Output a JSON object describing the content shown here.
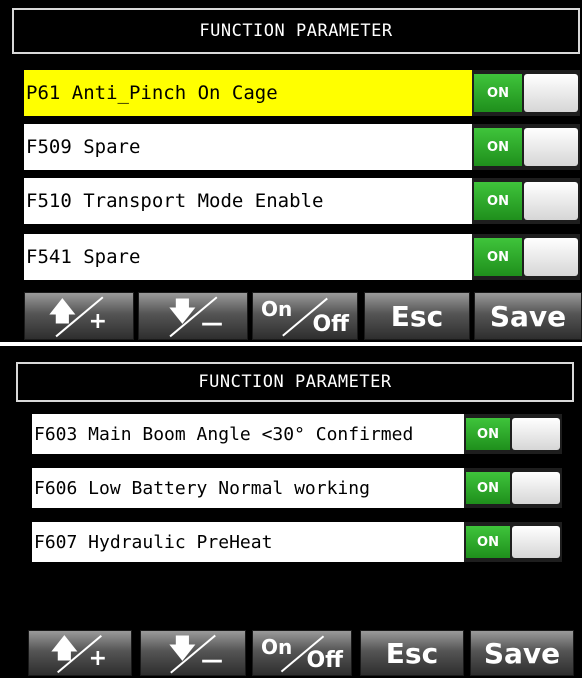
{
  "screens": [
    {
      "title": "FUNCTION PARAMETER",
      "rows": [
        {
          "label": "P61 Anti_Pinch On Cage",
          "toggle": "ON",
          "selected": true
        },
        {
          "label": "F509 Spare",
          "toggle": "ON",
          "selected": false
        },
        {
          "label": "F510 Transport Mode Enable",
          "toggle": "ON",
          "selected": false
        },
        {
          "label": "F541 Spare",
          "toggle": "ON",
          "selected": false
        }
      ]
    },
    {
      "title": "FUNCTION PARAMETER",
      "rows": [
        {
          "label": "F603 Main Boom Angle <30°  Confirmed",
          "toggle": "ON",
          "selected": false
        },
        {
          "label": "F606 Low Battery Normal working",
          "toggle": "ON",
          "selected": false
        },
        {
          "label": "F607 Hydraulic PreHeat",
          "toggle": "ON",
          "selected": false
        }
      ]
    }
  ],
  "buttons": {
    "up_plus_symbol": "+",
    "down_minus_symbol": "—",
    "onoff_on": "On",
    "onoff_off": "Off",
    "esc": "Esc",
    "save": "Save"
  },
  "colors": {
    "selected_row": "#ffff00",
    "toggle_on": "#2aa526",
    "background": "#000000"
  },
  "icons": {
    "up": "up-arrow-icon",
    "down": "down-arrow-icon"
  }
}
